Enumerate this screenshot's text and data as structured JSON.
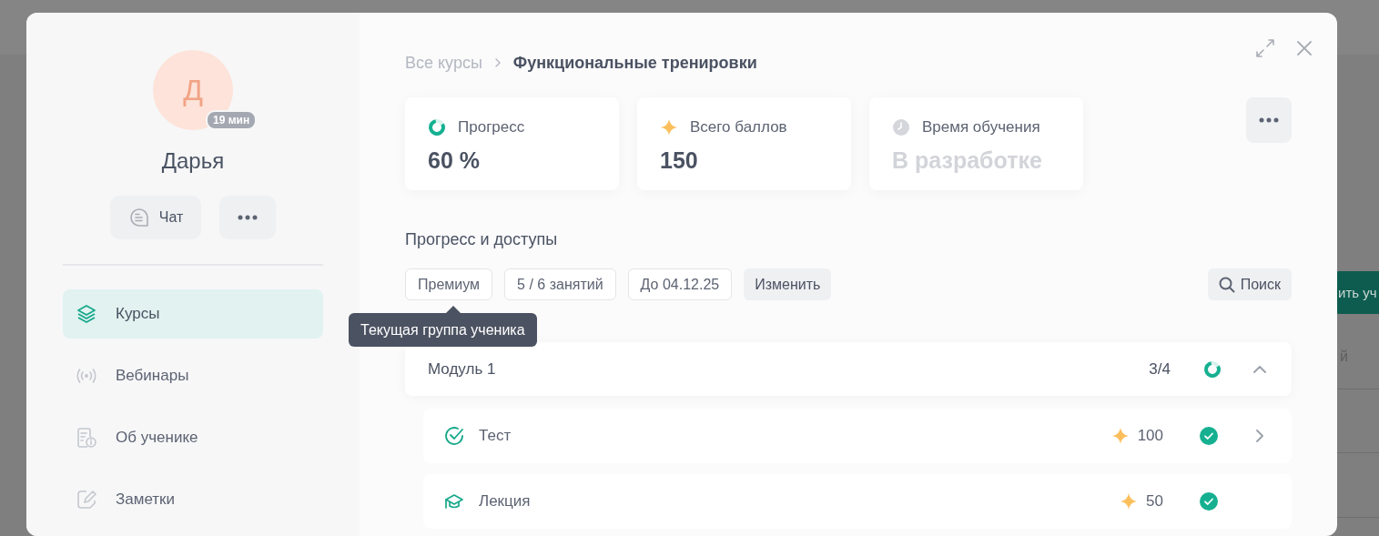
{
  "backdrop": {
    "fragments": [
      {
        "kind": "button",
        "text": "ить уч"
      },
      {
        "kind": "column",
        "text": "й"
      }
    ]
  },
  "student": {
    "initial": "Д",
    "last_seen": "19 мин",
    "name": "Дарья"
  },
  "actions": [
    {
      "kind": "chat",
      "label": "Чат"
    },
    {
      "kind": "more"
    }
  ],
  "nav": [
    {
      "label": "Курсы",
      "selected": true
    },
    {
      "label": "Вебинары",
      "selected": false
    },
    {
      "label": "Об ученике",
      "selected": false
    },
    {
      "label": "Заметки",
      "selected": false
    }
  ],
  "breadcrumb": [
    "Все курсы",
    "Функциональные тренировки"
  ],
  "stats": [
    {
      "label": "Прогресс",
      "value": "60 %",
      "disabled": false
    },
    {
      "label": "Всего баллов",
      "value": "150",
      "disabled": false
    },
    {
      "label": "Время обучения",
      "value": "В разработке",
      "disabled": true
    }
  ],
  "access": {
    "title": "Прогресс и доступы",
    "chips": [
      "Премиум",
      "5 / 6 занятий",
      "До 04.12.25"
    ],
    "edit_button": "Изменить",
    "search_button": "Поиск",
    "tooltip": "Текущая группа ученика"
  },
  "modules": [
    {
      "title": "Модуль 1",
      "count": "3/4",
      "expanded": true,
      "lessons": [
        {
          "kind": "test",
          "title": "Тест",
          "points": "100",
          "done": true,
          "has_details": true
        },
        {
          "kind": "lecture",
          "title": "Лекция",
          "points": "50",
          "done": true,
          "has_details": false
        }
      ]
    }
  ]
}
